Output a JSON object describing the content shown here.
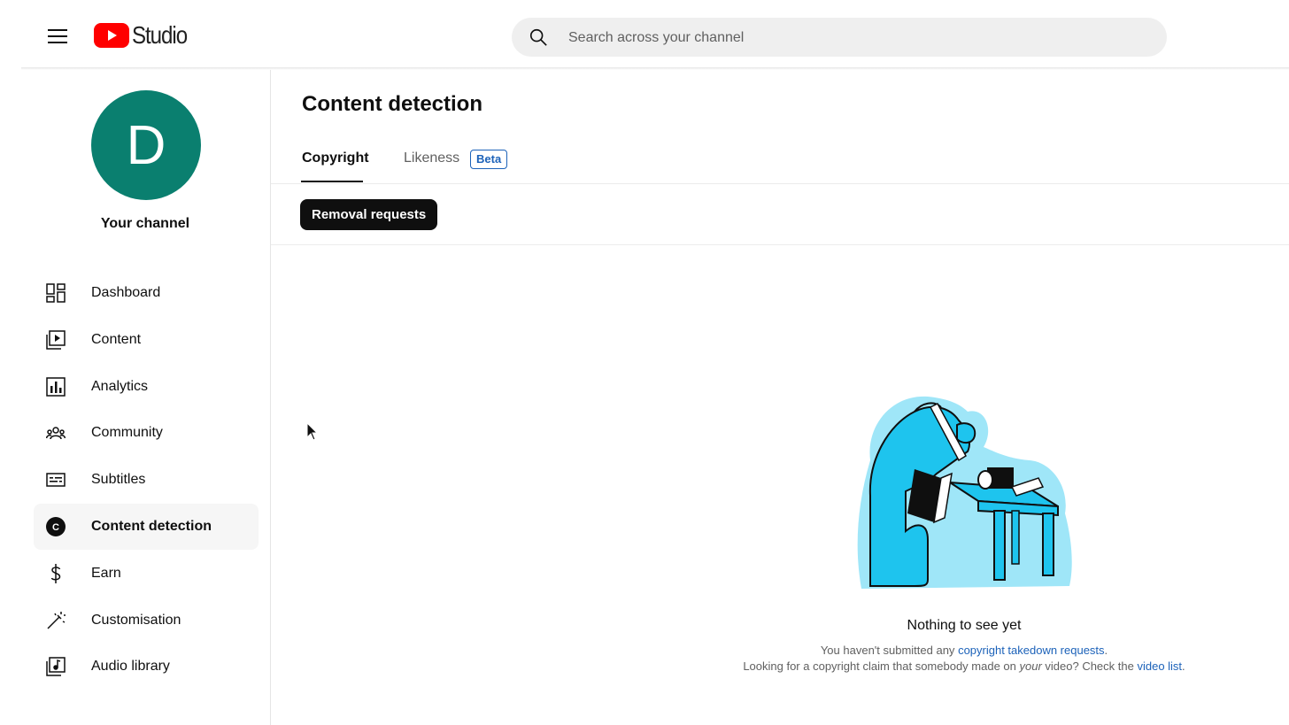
{
  "header": {
    "logo_text": "Studio",
    "search_placeholder": "Search across your channel"
  },
  "sidebar": {
    "avatar_letter": "D",
    "channel_label": "Your channel",
    "items": [
      {
        "label": "Dashboard",
        "icon": "dashboard-icon"
      },
      {
        "label": "Content",
        "icon": "content-icon"
      },
      {
        "label": "Analytics",
        "icon": "analytics-icon"
      },
      {
        "label": "Community",
        "icon": "community-icon"
      },
      {
        "label": "Subtitles",
        "icon": "subtitles-icon"
      },
      {
        "label": "Content detection",
        "icon": "content-detection-icon",
        "active": true
      },
      {
        "label": "Earn",
        "icon": "earn-icon"
      },
      {
        "label": "Customisation",
        "icon": "customisation-icon"
      },
      {
        "label": "Audio library",
        "icon": "audio-library-icon"
      }
    ]
  },
  "main": {
    "title": "Content detection",
    "tabs": [
      {
        "label": "Copyright",
        "selected": true
      },
      {
        "label": "Likeness",
        "badge": "Beta"
      }
    ],
    "chip_label": "Removal requests",
    "empty_state": {
      "title": "Nothing to see yet",
      "line1_prefix": "You haven't submitted any ",
      "line1_link": "copyright takedown requests",
      "line1_suffix": ".",
      "line2_prefix": "Looking for a copyright claim that somebody made on ",
      "line2_em": "your",
      "line2_middle": " video? Check the ",
      "line2_link": "video list",
      "line2_suffix": "."
    }
  },
  "colors": {
    "brand_red": "#ff0000",
    "avatar": "#0a7f6f",
    "link": "#1c62b9",
    "illustration_fill": "#1ec4ee"
  }
}
